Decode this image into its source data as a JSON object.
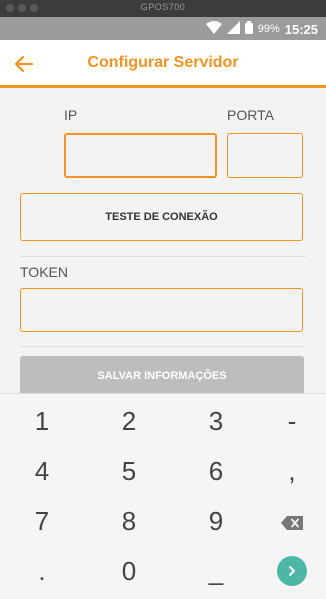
{
  "window": {
    "title": "GPOS700"
  },
  "status_bar": {
    "battery": "99%",
    "time": "15:25"
  },
  "app_bar": {
    "title": "Configurar Servidor"
  },
  "form": {
    "ip_label": "IP",
    "port_label": "PORTA",
    "ip_value": "",
    "port_value": "",
    "test_button": "TESTE DE CONEXÃO",
    "token_label": "TOKEN",
    "token_value": "",
    "save_button": "SALVAR INFORMAÇÕES"
  },
  "keyboard": {
    "rows": [
      [
        "1",
        "2",
        "3",
        "-"
      ],
      [
        "4",
        "5",
        "6",
        ","
      ],
      [
        "7",
        "8",
        "9",
        "backspace"
      ],
      [
        ".",
        "0",
        "_",
        "go"
      ]
    ]
  },
  "colors": {
    "accent": "#f29322",
    "go_button": "#4db6a4"
  }
}
